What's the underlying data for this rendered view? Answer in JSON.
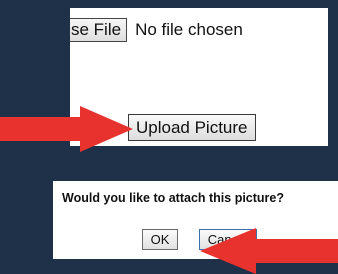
{
  "file_input": {
    "choose_button_label": "se File",
    "status_text": "No file chosen"
  },
  "upload": {
    "button_label": "Upload Picture"
  },
  "confirm_dialog": {
    "message": "Would you like to attach this picture?",
    "ok_label": "OK",
    "cancel_label": "Cancel"
  },
  "annotations": {
    "arrow_color": "#e8322e",
    "background_color": "#1e3148",
    "icons": [
      "arrow-right-icon",
      "arrow-left-icon"
    ]
  }
}
